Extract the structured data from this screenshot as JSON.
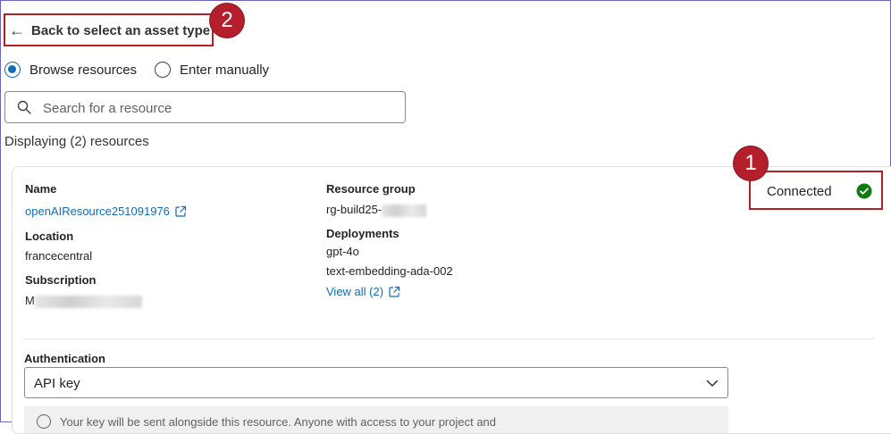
{
  "back": {
    "label": "Back to select an asset type",
    "arrow": "←",
    "badge": "2"
  },
  "mode": {
    "options": [
      {
        "label": "Browse resources",
        "checked": true
      },
      {
        "label": "Enter manually",
        "checked": false
      }
    ]
  },
  "search": {
    "placeholder": "Search for a resource",
    "value": ""
  },
  "results": {
    "count_text": "Displaying (2) resources"
  },
  "resource": {
    "name_label": "Name",
    "name_value": "openAIResource251091976",
    "location_label": "Location",
    "location_value": "francecentral",
    "subscription_label": "Subscription",
    "subscription_value_prefix": "M",
    "resource_group_label": "Resource group",
    "resource_group_prefix": "rg-build25-",
    "deployments_label": "Deployments",
    "deployments": [
      "gpt-4o",
      "text-embedding-ada-002"
    ],
    "view_all": "View all (2)",
    "status": "Connected",
    "status_badge": "1",
    "status_color": "#107c10"
  },
  "auth": {
    "label": "Authentication",
    "value": "API key"
  },
  "info": {
    "text": "Your key will be sent alongside this resource. Anyone with access to your project and"
  },
  "colors": {
    "accent": "#0f6cbd",
    "annotation": "#b32024"
  }
}
